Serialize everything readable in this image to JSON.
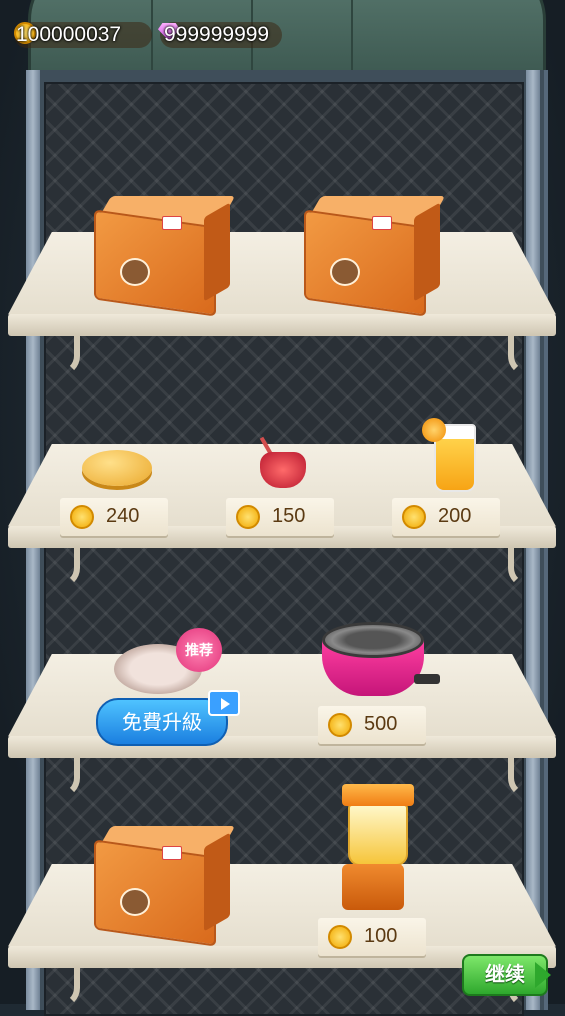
{
  "currency": {
    "coins": "100000037",
    "gems": "999999999"
  },
  "shelves": {
    "row1": {
      "items": [
        {
          "icon": "mystery-box-icon"
        },
        {
          "icon": "mystery-box-icon"
        }
      ]
    },
    "row2": {
      "items": [
        {
          "icon": "cheese-icon",
          "price": "240"
        },
        {
          "icon": "jam-jar-icon",
          "price": "150"
        },
        {
          "icon": "orange-juice-icon",
          "price": "200"
        }
      ]
    },
    "row3": {
      "plate": {
        "icon": "plate-icon",
        "badge": "推荐",
        "upgrade_label": "免費升級"
      },
      "pot": {
        "icon": "pot-icon",
        "price": "500"
      }
    },
    "row4": {
      "box": {
        "icon": "mystery-box-icon"
      },
      "blender": {
        "icon": "juicer-icon",
        "price": "100"
      }
    }
  },
  "continue_label": "继续"
}
